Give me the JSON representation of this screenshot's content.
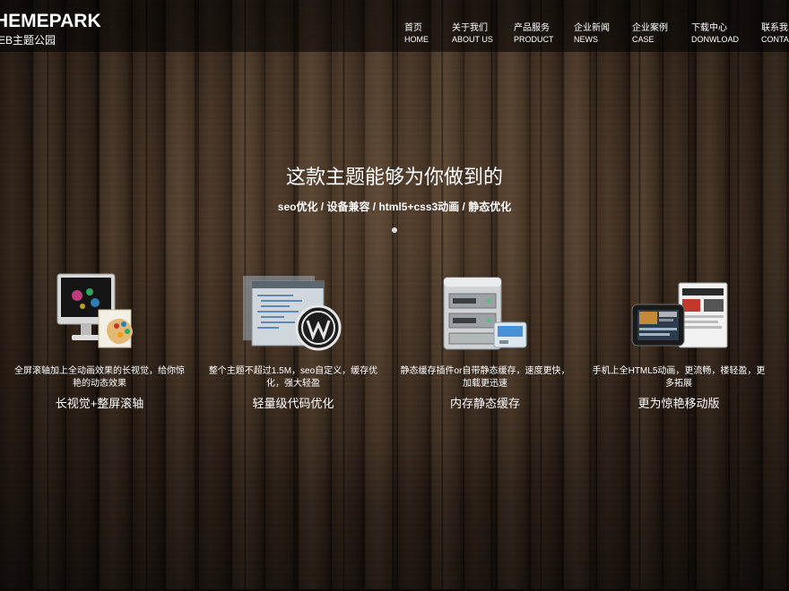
{
  "header": {
    "logo_main": "HEMEPARK",
    "logo_sub": "EB主题公园",
    "nav": [
      {
        "cn": "首页",
        "en": "HOME"
      },
      {
        "cn": "关于我们",
        "en": "ABOUT US"
      },
      {
        "cn": "产品服务",
        "en": "PRODUCT"
      },
      {
        "cn": "企业新闻",
        "en": "NEWS"
      },
      {
        "cn": "企业案例",
        "en": "CASE"
      },
      {
        "cn": "下载中心",
        "en": "DONWLOAD"
      },
      {
        "cn": "联系我",
        "en": "CONTA"
      }
    ]
  },
  "hero": {
    "title": "这款主题能够为你做到的",
    "subtitle": "seo优化 / 设备兼容 / html5+css3动画 / 静态优化"
  },
  "features": [
    {
      "icon": "monitor-palette-icon",
      "desc": "全屏滚轴加上全动画效果的长视觉，给你惊艳的动态效果",
      "title": "长视觉+整屏滚轴"
    },
    {
      "icon": "wordpress-code-icon",
      "desc": "整个主题不超过1.5M，seo自定义，缓存优化，强大轻盈",
      "title": "轻量级代码优化"
    },
    {
      "icon": "server-cache-icon",
      "desc": "静态缓存插件or自带静态缓存，速度更快，加载更迅速",
      "title": "内存静态缓存"
    },
    {
      "icon": "tablet-mobile-icon",
      "desc": "手机上全HTML5动画，更流畅，楼轻盈，更多拓展",
      "title": "更为惊艳移动版"
    }
  ]
}
